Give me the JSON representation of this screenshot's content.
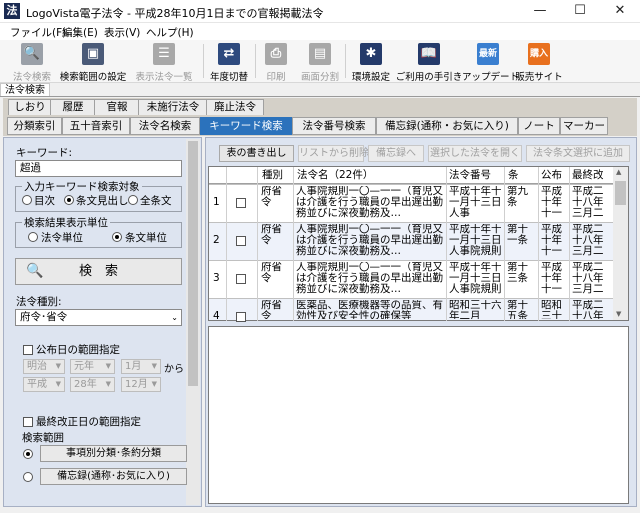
{
  "window": {
    "title": "LogoVista電子法令 - 平成28年10月1日までの官報掲載法令",
    "app_icon_glyph": "法",
    "minimize": "—",
    "maximize": "☐",
    "close": "✕"
  },
  "menu": [
    "ファイル(F)",
    "編集(E)",
    "表示(V)",
    "ヘルプ(H)"
  ],
  "toolbar": [
    {
      "label": "法令検索",
      "icon": "search-icon",
      "glyph": "🔍",
      "color": "#9aa0a8",
      "disabled": true
    },
    {
      "label": "検索範囲の設定",
      "icon": "scope-icon",
      "glyph": "▣",
      "color": "#4a5a78",
      "disabled": false
    },
    {
      "label": "表示法令一覧",
      "icon": "list-icon",
      "glyph": "☰",
      "color": "#a8a8a8",
      "disabled": true
    },
    {
      "label": "年度切替",
      "icon": "switch-icon",
      "glyph": "⇄",
      "color": "#2e4a7e",
      "disabled": false
    },
    {
      "label": "印刷",
      "icon": "print-icon",
      "glyph": "⎙",
      "color": "#a8a8a8",
      "disabled": true
    },
    {
      "label": "画面分割",
      "icon": "split-icon",
      "glyph": "▤",
      "color": "#a8a8a8",
      "disabled": true
    },
    {
      "label": "環境設定",
      "icon": "gear-icon",
      "glyph": "✱",
      "color": "#243a6a",
      "disabled": false
    },
    {
      "label": "ご利用の手引き",
      "icon": "book-icon",
      "glyph": "📖",
      "color": "#243a6a",
      "disabled": false
    },
    {
      "label": "アップデート",
      "icon": "update-icon",
      "glyph": "最新",
      "color": "#3a7fd0",
      "disabled": false
    },
    {
      "label": "販売サイト",
      "icon": "cart-icon",
      "glyph": "購入",
      "color": "#e8701e",
      "disabled": false
    }
  ],
  "doc_tab": "法令検索",
  "tabs_row1": [
    "しおり",
    "履歴",
    "官報",
    "未施行法令",
    "廃止法令"
  ],
  "tabs_row2": [
    "分類索引",
    "五十音索引",
    "法令名検索",
    "キーワード検索",
    "法令番号検索",
    "備忘録(通称・お気に入り)",
    "ノート",
    "マーカー"
  ],
  "active_tab": "キーワード検索",
  "left": {
    "keyword_label": "キーワード:",
    "keyword_value": "超過",
    "target_group_label": "入力キーワード検索対象",
    "target_options": [
      "目次",
      "条文見出し",
      "全条文"
    ],
    "target_selected": 1,
    "unit_group_label": "検索結果表示単位",
    "unit_options": [
      "法令単位",
      "条文単位"
    ],
    "unit_selected": 1,
    "search_button": "検　索",
    "type_label": "法令種別:",
    "type_value": "府令･省令",
    "pub_date_label": "公布日の範囲指定",
    "date_from": [
      "明治",
      "元年",
      "1月"
    ],
    "date_to": [
      "平成",
      "28年",
      "12月"
    ],
    "from_label": "から",
    "last_rev_label": "最終改正日の範囲指定",
    "scope_label": "検索範囲",
    "scope_options": [
      "事項別分類･条約分類",
      "備忘録(通称･お気に入り)"
    ],
    "scope_selected": 0
  },
  "right": {
    "buttons": [
      {
        "label": "表の書き出し",
        "disabled": false
      },
      {
        "label": "リストから削除",
        "disabled": true
      },
      {
        "label": "備忘録へ",
        "disabled": true
      },
      {
        "label": "選択した法令を開く",
        "disabled": true
      },
      {
        "label": "法令条文選択に追加",
        "disabled": true
      }
    ],
    "columns": [
      "",
      "",
      "種別",
      "法令名（22件）",
      "法令番号",
      "条",
      "公布",
      "最終改"
    ],
    "rows": [
      {
        "no": "1",
        "type": "府省令",
        "name": "人事院規則一〇—一一（育児又は介護を行う職員の早出遅出勤務並びに深夜勤務及…",
        "number": "平成十年十一月十三日人事",
        "article": "第九条",
        "pub": "平成十年十一",
        "last": "平成二十八年三月二"
      },
      {
        "no": "2",
        "type": "府省令",
        "name": "人事院規則一〇—一一（育児又は介護を行う職員の早出遅出勤務並びに深夜勤務及…",
        "number": "平成十年十一月十三日人事院規則",
        "article": "第十一条",
        "pub": "平成十年十一",
        "last": "平成二十八年三月二"
      },
      {
        "no": "3",
        "type": "府省令",
        "name": "人事院規則一〇—一一（育児又は介護を行う職員の早出遅出勤務並びに深夜勤務及…",
        "number": "平成十年十一月十三日人事院規則",
        "article": "第十三条",
        "pub": "平成十年十一",
        "last": "平成二十八年三月二"
      },
      {
        "no": "4",
        "type": "府省令",
        "name": "医薬品、医療機器等の品質、有効性及び安全性の確保等",
        "number": "昭和三十六年二月",
        "article": "第十五条",
        "pub": "昭和三十",
        "last": "平成二十八年"
      }
    ]
  }
}
